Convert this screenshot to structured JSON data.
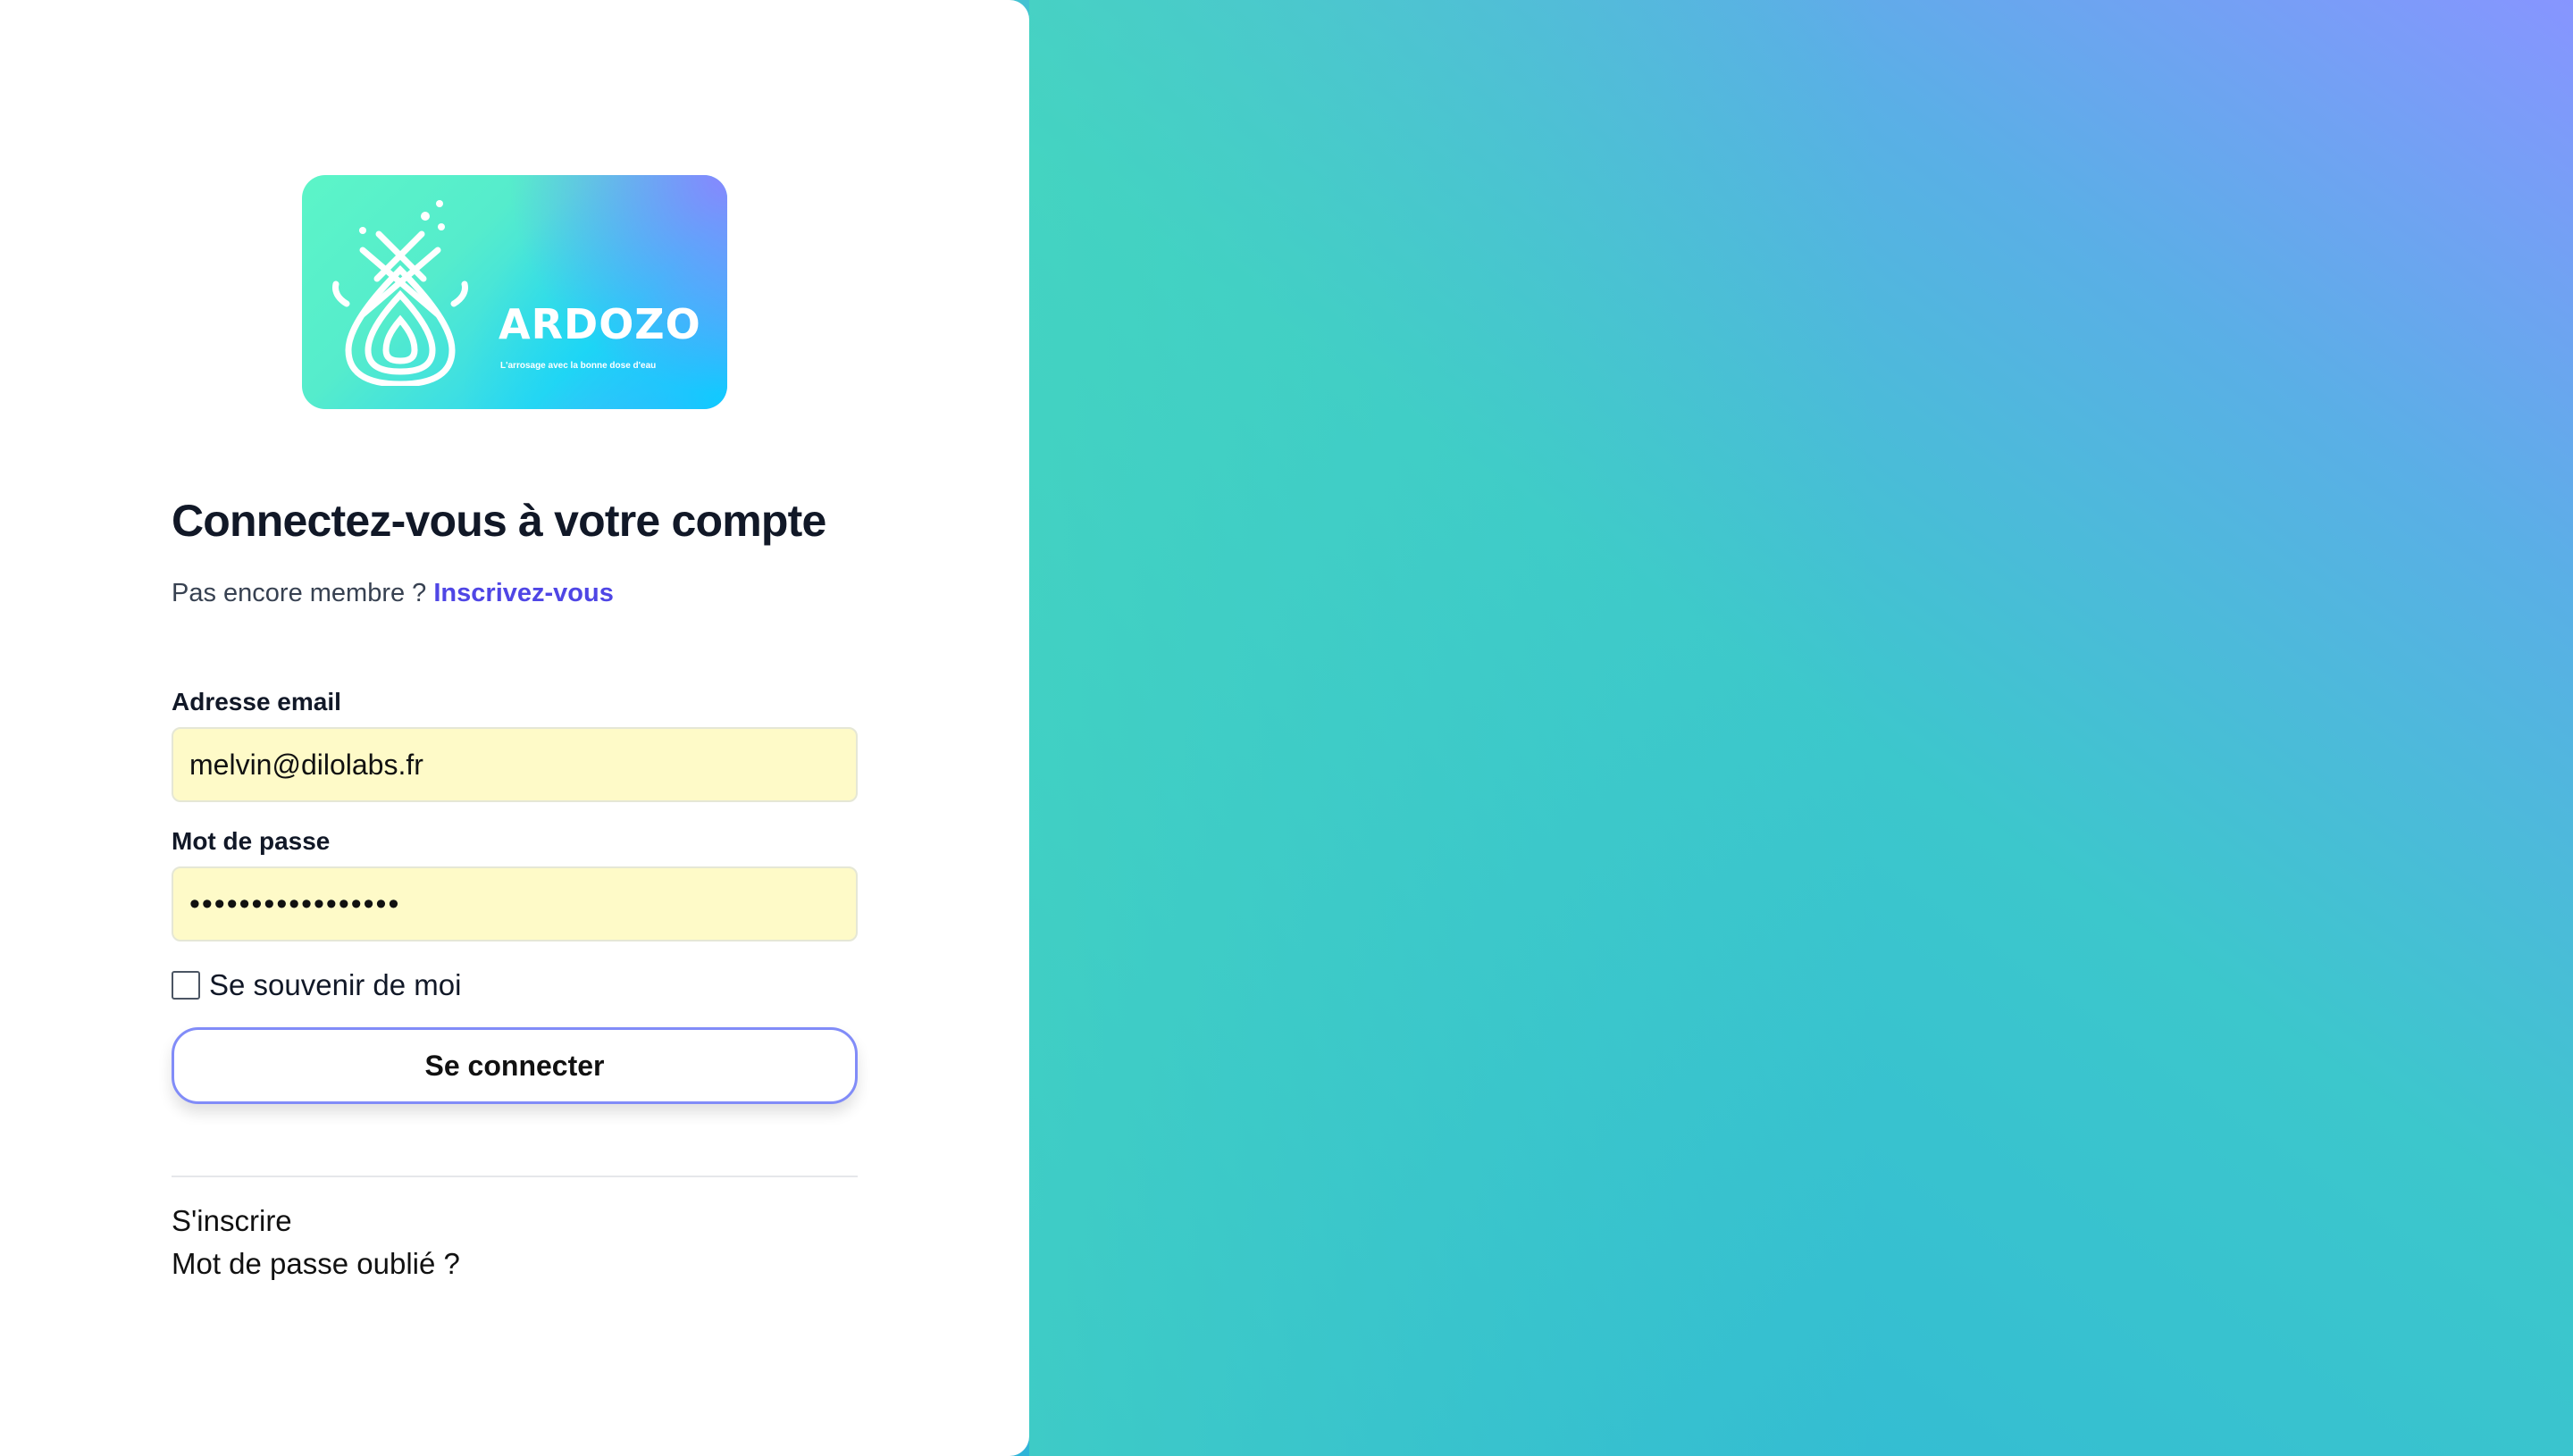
{
  "brand": {
    "name": "ARDOZO",
    "tagline": "L'arrosage avec la bonne dose d'eau"
  },
  "login": {
    "title": "Connectez-vous à votre compte",
    "subtitle_prefix": "Pas encore membre ?",
    "subtitle_link": "Inscrivez-vous",
    "email_label": "Adresse email",
    "email_value": "melvin@dilolabs.fr",
    "password_label": "Mot de passe",
    "password_value": "•••••••••••••••••",
    "remember_label": "Se souvenir de moi",
    "submit_label": "Se connecter"
  },
  "footer_links": {
    "signup": "S'inscrire",
    "forgot": "Mot de passe oublié ?"
  },
  "colors": {
    "accent": "#4f46e5",
    "button_border": "#818cf8",
    "autofill_bg": "#fefac8"
  }
}
